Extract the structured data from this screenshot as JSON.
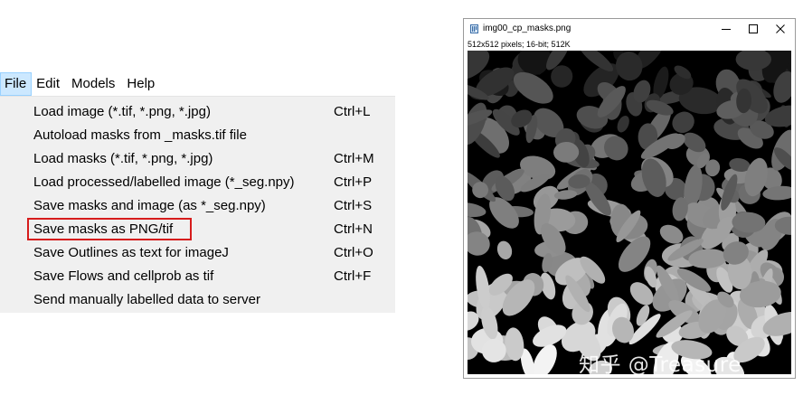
{
  "menubar": {
    "items": [
      "File",
      "Edit",
      "Models",
      "Help"
    ]
  },
  "file_menu": {
    "items": [
      {
        "label": "Load image (*.tif, *.png, *.jpg)",
        "shortcut": "Ctrl+L"
      },
      {
        "label": "Autoload masks from _masks.tif file",
        "shortcut": ""
      },
      {
        "label": "Load masks (*.tif, *.png, *.jpg)",
        "shortcut": "Ctrl+M"
      },
      {
        "label": "Load processed/labelled image (*_seg.npy)",
        "shortcut": "Ctrl+P"
      },
      {
        "label": "Save masks and image (as *_seg.npy)",
        "shortcut": "Ctrl+S"
      },
      {
        "label": "Save masks as PNG/tif",
        "shortcut": "Ctrl+N"
      },
      {
        "label": "Save Outlines as text for imageJ",
        "shortcut": "Ctrl+O"
      },
      {
        "label": "Save Flows and cellprob as tif",
        "shortcut": "Ctrl+F"
      },
      {
        "label": "Send manually labelled data to server",
        "shortcut": ""
      }
    ],
    "highlighted_item": "Save masks as PNG/tif",
    "highlight_color": "#d61c1c"
  },
  "image_window": {
    "title": "img00_cp_masks.png",
    "info": "512x512 pixels; 16-bit; 512K",
    "buttons": {
      "minimize": "minimize-icon",
      "maximize": "maximize-icon",
      "close": "close-icon"
    },
    "content": "grayscale segmentation mask: brighter cells toward the bottom, darker toward the top"
  },
  "watermark": "知乎 @Treasure",
  "colors": {
    "menu_bg": "#f0f0f0",
    "menu_active": "#cce8ff",
    "highlight": "#d61c1c"
  }
}
